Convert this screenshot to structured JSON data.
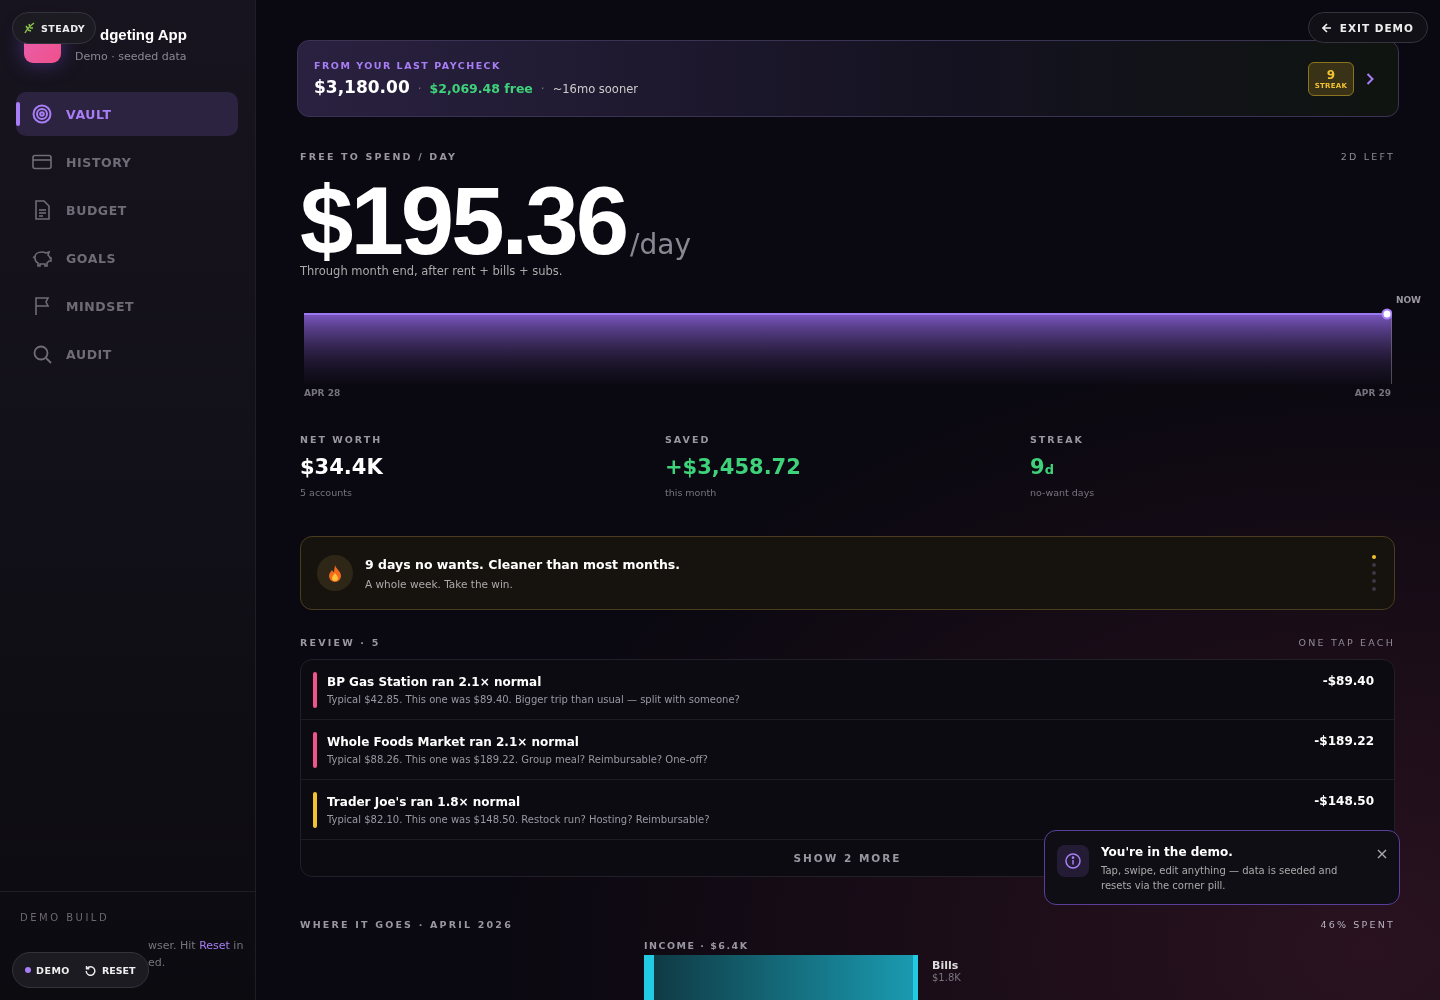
{
  "app": {
    "title": "dgeting App",
    "subtitle": "Demo · seeded data"
  },
  "mood_pill": {
    "label": "STEADY"
  },
  "exit_button": {
    "label": "EXIT DEMO"
  },
  "sidebar": {
    "items": [
      {
        "label": "VAULT",
        "selected": true
      },
      {
        "label": "HISTORY",
        "selected": false
      },
      {
        "label": "BUDGET",
        "selected": false
      },
      {
        "label": "GOALS",
        "selected": false
      },
      {
        "label": "MINDSET",
        "selected": false
      },
      {
        "label": "AUDIT",
        "selected": false
      }
    ],
    "footer": {
      "heading": "DEMO BUILD",
      "line_1": "wser. Hit **Reset** in",
      "line_2": "ed."
    }
  },
  "demo_pill": {
    "label": "DEMO",
    "reset": "RESET"
  },
  "paycheck": {
    "heading": "FROM YOUR LAST PAYCHECK",
    "amount": "$3,180.00",
    "separator_1": "·",
    "separator_2": "·",
    "free": "$2,069.48 free",
    "sooner": "~16mo sooner",
    "streak_value": "9",
    "streak_label": "STREAK"
  },
  "free_to_spend": {
    "heading": "FREE TO SPEND / DAY",
    "days_left": "2D LEFT",
    "amount": "$195.36",
    "unit": "/day",
    "note": "Through month end, after rent + bills + subs.",
    "chart": {
      "start": "APR 28",
      "end": "APR 29",
      "now": "NOW"
    }
  },
  "stats": [
    {
      "kind": "plain",
      "label": "NET WORTH",
      "value": "$34.4K",
      "note": "5 accounts"
    },
    {
      "kind": "positive",
      "label": "SAVED",
      "value": "+$3,458.72",
      "note": "this month"
    },
    {
      "kind": "positive",
      "label": "STREAK",
      "value": "9",
      "unit": "d",
      "note": "no-want days"
    }
  ],
  "insight": {
    "title": "9 days no wants. Cleaner than most months.",
    "text": "A whole week. Take the win.",
    "pages": [
      {
        "selected": true
      },
      {
        "selected": false
      },
      {
        "selected": false
      },
      {
        "selected": false
      },
      {
        "selected": false
      }
    ]
  },
  "review": {
    "heading": "REVIEW · 5",
    "hint": "ONE TAP EACH",
    "more": "SHOW 2 MORE",
    "rows": [
      {
        "title": "BP Gas Station ran 2.1× normal",
        "text": "Typical $42.85. This one was $89.40. Bigger trip than usual — split with someone?",
        "amount": "-$89.40",
        "color": "#f0548a"
      },
      {
        "title": "Whole Foods Market ran 2.1× normal",
        "text": "Typical $88.26. This one was $189.22. Group meal? Reimbursable? One-off?",
        "amount": "-$189.22",
        "color": "#f0548a"
      },
      {
        "title": "Trader Joe's ran 1.8× normal",
        "text": "Typical $82.10. This one was $148.50. Restock run? Hosting? Reimbursable?",
        "amount": "-$148.50",
        "color": "#f2c230"
      }
    ]
  },
  "where_it_goes": {
    "heading": "WHERE IT GOES · APRIL 2026",
    "spent": "46% SPENT",
    "income": "INCOME · $6.4K",
    "flows": [
      {
        "name": "Bills",
        "amount": "$1.8K"
      }
    ]
  },
  "toast": {
    "title": "You're in the demo.",
    "text": "Tap, swipe, edit anything — data is seeded and resets via the corner pill."
  }
}
